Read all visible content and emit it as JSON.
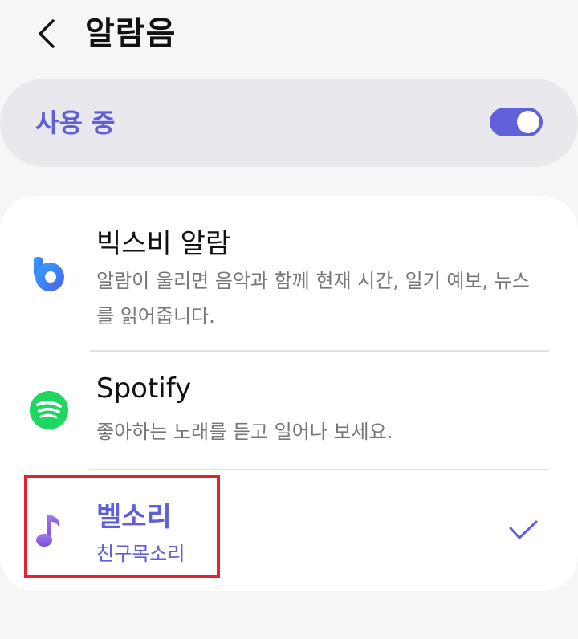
{
  "header": {
    "back_icon": "chevron-left-icon",
    "title": "알람음"
  },
  "master": {
    "label": "사용 중",
    "toggle_on": true,
    "accent": "#5f5fd9"
  },
  "items": [
    {
      "icon": "bixby-icon",
      "title": "빅스비 알람",
      "desc": "알람이 울리면 음악과 함께 현재 시간, 일기 예보, 뉴스를 읽어줍니다."
    },
    {
      "icon": "spotify-icon",
      "title": "Spotify",
      "desc": "좋아하는 노래를 듣고 일어나 보세요."
    },
    {
      "icon": "music-note-icon",
      "title": "벨소리",
      "desc": "친구목소리",
      "selected": true,
      "check_icon": "checkmark-icon"
    }
  ],
  "colors": {
    "bixby": "#3a7cf0",
    "spotify": "#1ed760",
    "highlight": "#e0242e"
  }
}
